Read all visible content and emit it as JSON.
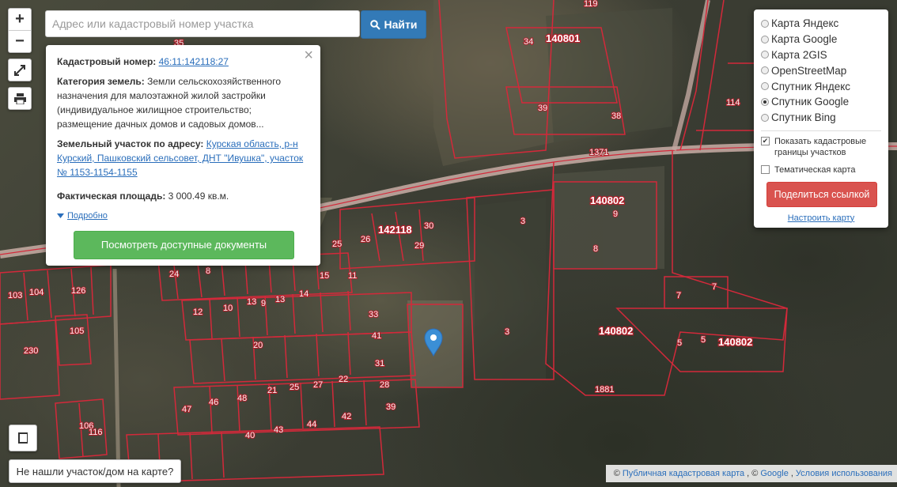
{
  "search": {
    "placeholder": "Адрес или кадастровый номер участка",
    "button_label": "Найти"
  },
  "zoom": {
    "in": "+",
    "out": "−"
  },
  "info_popup": {
    "cad_number_label": "Кадастровый номер:",
    "cad_number": "46:11:142118:27",
    "category_label": "Категория земель:",
    "category_value": "Земли сельскохозяйственного назначения для малоэтажной жилой застройки (индивидуальное жилищное строительство; размещение дачных домов и садовых домов...",
    "address_label": "Земельный участок по адресу:",
    "address_value": "Курская область, р-н Курский, Пашковский сельсовет, ДНТ \"Ивушка\", участок № 1153-1154-1155",
    "area_label": "Фактическая площадь:",
    "area_value": "3 000.49 кв.м.",
    "more_label": "Подробно",
    "docs_button": "Посмотреть доступные документы"
  },
  "layers": {
    "options": [
      {
        "label": "Карта Яндекс",
        "selected": false
      },
      {
        "label": "Карта Google",
        "selected": false
      },
      {
        "label": "Карта 2GIS",
        "selected": false
      },
      {
        "label": "OpenStreetMap",
        "selected": false
      },
      {
        "label": "Спутник Яндекс",
        "selected": false
      },
      {
        "label": "Спутник Google",
        "selected": true
      },
      {
        "label": "Спутник Bing",
        "selected": false
      }
    ],
    "show_boundaries": {
      "label": "Показать кадастровые границы участков",
      "checked": true
    },
    "thematic": {
      "label": "Тематическая карта",
      "checked": false
    },
    "share_button": "Поделиться ссылкой",
    "configure_link": "Настроить карту"
  },
  "map_labels": {
    "quarters": [
      "140801",
      "140802",
      "142118",
      "140802",
      "140802"
    ],
    "plots": [
      "119",
      "34",
      "39",
      "38",
      "114",
      "1371",
      "9",
      "8",
      "7",
      "7",
      "5",
      "5",
      "1881",
      "3",
      "3",
      "30",
      "29",
      "25",
      "26",
      "24",
      "8",
      "11",
      "15",
      "126",
      "33",
      "41",
      "31",
      "28",
      "39",
      "42",
      "44",
      "43",
      "40",
      "46",
      "47",
      "48",
      "21",
      "25",
      "27",
      "22",
      "20",
      "13",
      "14",
      "9",
      "10",
      "12",
      "13",
      "103",
      "104",
      "105",
      "106",
      "116",
      "230",
      "35"
    ]
  },
  "marker": {
    "icon": "map-pin-icon",
    "color": "#3b8fd6"
  },
  "bottom": {
    "not_found_button": "Не нашли участок/дом на карте?",
    "attribution_prefix": "©",
    "attribution_link1": "Публичная кадастровая карта",
    "attribution_sep": ", ©",
    "attribution_link2": "Google",
    "attribution_link3": "Условия использования"
  },
  "colors": {
    "boundary": "#d3293a",
    "road": "#c7a8a4",
    "search_button": "#337ab7",
    "docs_button": "#5cb85c",
    "share_button": "#d9534f"
  }
}
